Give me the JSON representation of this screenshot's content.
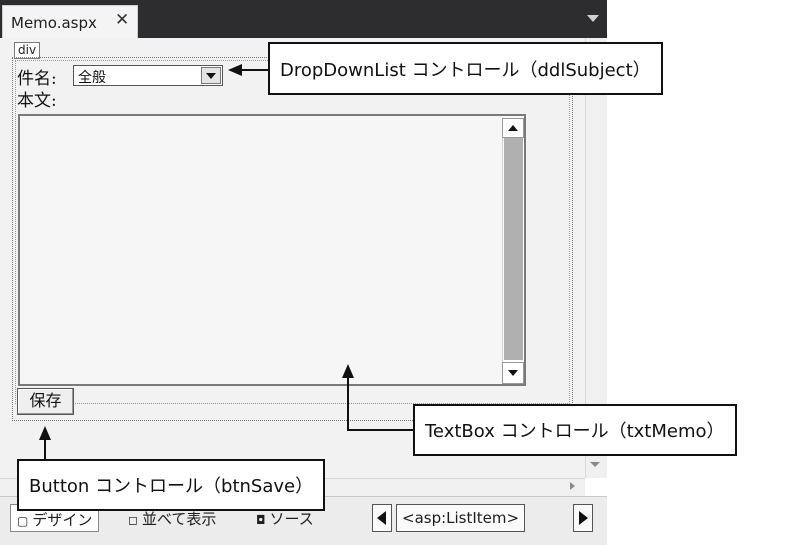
{
  "document_tab": {
    "title": "Memo.aspx",
    "close_glyph": "✕"
  },
  "design_surface": {
    "div_tag": "div",
    "subject_label": "件名:",
    "subject_select": {
      "selected": "全般"
    },
    "body_label": "本文:",
    "save_button_label": "保存"
  },
  "view_tabs": [
    {
      "glyph": "▢",
      "label": "デザイン"
    },
    {
      "glyph": "◻",
      "label": "並べて表示"
    },
    {
      "glyph": "◘",
      "label": "ソース"
    }
  ],
  "breadcrumb": {
    "tag": "<asp:ListItem>"
  },
  "callouts": {
    "dropdown": "DropDownList コントロール（ddlSubject）",
    "textbox": "TextBox コントロール（txtMemo）",
    "button": "Button コントロール（btnSave）"
  },
  "icons": [
    "close-icon",
    "dropdown-arrow-icon",
    "scroll-up-icon",
    "scroll-down-icon",
    "nav-left-icon",
    "nav-right-icon"
  ]
}
